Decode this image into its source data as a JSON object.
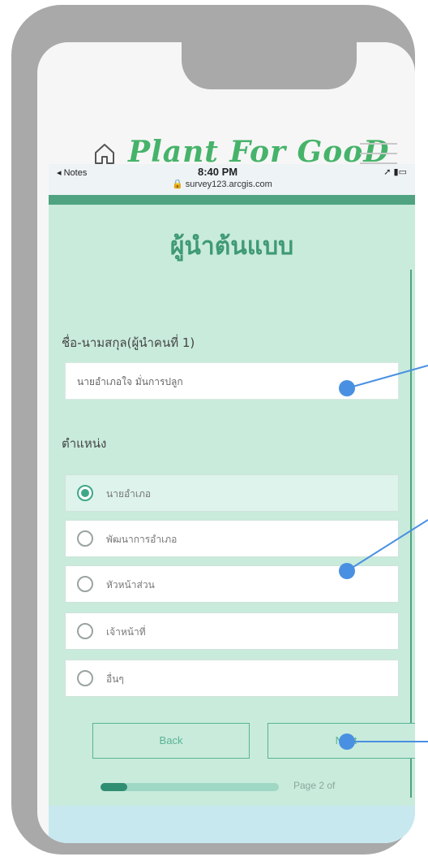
{
  "app": {
    "brand": "Plant For GooD",
    "icons": {
      "home": "home-icon",
      "menu": "hamburger-menu-icon"
    }
  },
  "status_bar": {
    "back_app": "◂ Notes",
    "time": "8:40 PM",
    "url": "🔒 survey123.arcgis.com"
  },
  "form": {
    "title": "ผู้นำต้นแบบ",
    "name_label": "ชื่อ-นามสกุล(ผู้นำคนที่ 1)",
    "name_value": "นายอำเภอใจ มั่นการปลูก",
    "position_label": "ตำแหน่ง",
    "options": [
      {
        "label": "นายอำเภอ",
        "selected": true
      },
      {
        "label": "พัฒนาการอำเภอ",
        "selected": false
      },
      {
        "label": "หัวหน้าส่วน",
        "selected": false
      },
      {
        "label": "เจ้าหน้าที่",
        "selected": false
      },
      {
        "label": "อื่นๆ",
        "selected": false
      }
    ],
    "back_label": "Back",
    "next_label": "Next",
    "page_text": "Page 2 of",
    "progress": 0.15
  },
  "colors": {
    "brand_green": "#46b36a",
    "form_green": "#3f9a74",
    "panel_bg": "#c9ebdc",
    "callout_blue": "#4a90e2"
  }
}
